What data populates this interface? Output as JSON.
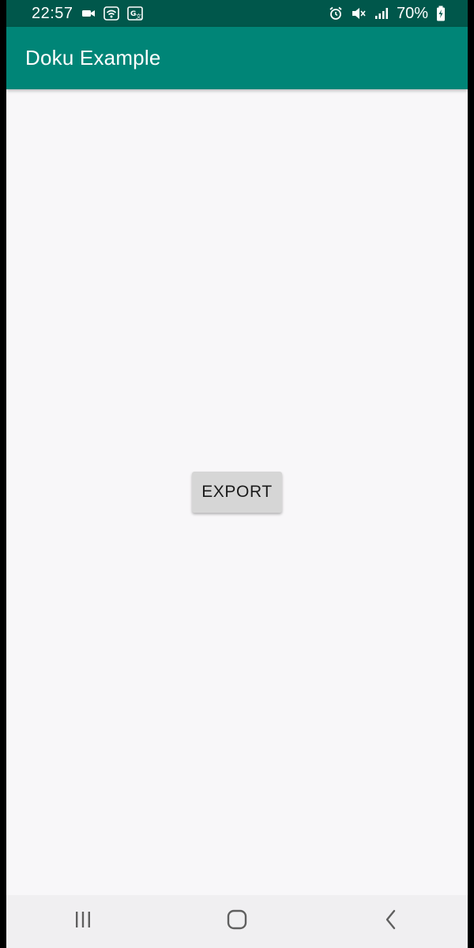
{
  "status_bar": {
    "time": "22:57",
    "battery_percent": "70%",
    "left_icons": [
      "video-camera-icon",
      "wifi-icon",
      "translate-icon"
    ],
    "right_icons": [
      "alarm-icon",
      "mute-icon",
      "signal-icon",
      "battery-icon"
    ]
  },
  "app_bar": {
    "title": "Doku Example"
  },
  "main": {
    "export_button_label": "EXPORT"
  },
  "nav_bar": {
    "icons": [
      "recent-apps-icon",
      "home-icon",
      "back-icon"
    ]
  },
  "colors": {
    "status_bar": "#00574b",
    "app_bar": "#008577",
    "background": "#f8f7f9",
    "button": "#d6d6d6",
    "nav_bar": "#f0eff1"
  }
}
